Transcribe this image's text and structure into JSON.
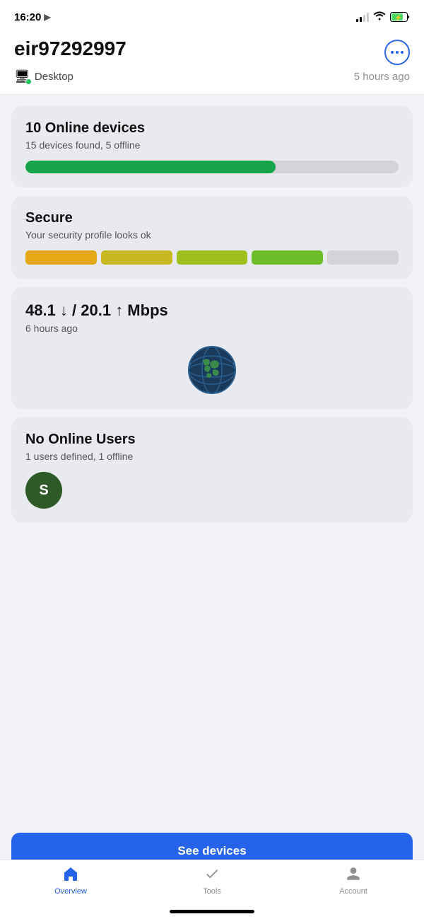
{
  "status_bar": {
    "time": "16:20",
    "battery_charging": true
  },
  "header": {
    "router_name": "eir97292997",
    "device_label": "Desktop",
    "time_ago": "5 hours ago",
    "more_button_label": "more options"
  },
  "devices_card": {
    "title": "10 Online devices",
    "subtitle": "15 devices found, 5 offline",
    "online": 10,
    "total": 15,
    "progress_percent": 67
  },
  "security_card": {
    "title": "Secure",
    "subtitle": "Your security profile looks ok",
    "segments": [
      {
        "color": "#e6a817"
      },
      {
        "color": "#c8b820"
      },
      {
        "color": "#a0c020"
      },
      {
        "color": "#6dbd2a"
      },
      {
        "color": "#d4d4d8"
      }
    ]
  },
  "speed_card": {
    "title": "48.1 ↓ / 20.1 ↑ Mbps",
    "subtitle": "6 hours ago"
  },
  "users_card": {
    "title": "No Online Users",
    "subtitle": "1 users defined, 1 offline",
    "avatar_letter": "S"
  },
  "see_devices_button": {
    "label": "See devices"
  },
  "bottom_nav": {
    "items": [
      {
        "id": "overview",
        "label": "Overview",
        "active": true
      },
      {
        "id": "tools",
        "label": "Tools",
        "active": false
      },
      {
        "id": "account",
        "label": "Account",
        "active": false
      }
    ]
  }
}
